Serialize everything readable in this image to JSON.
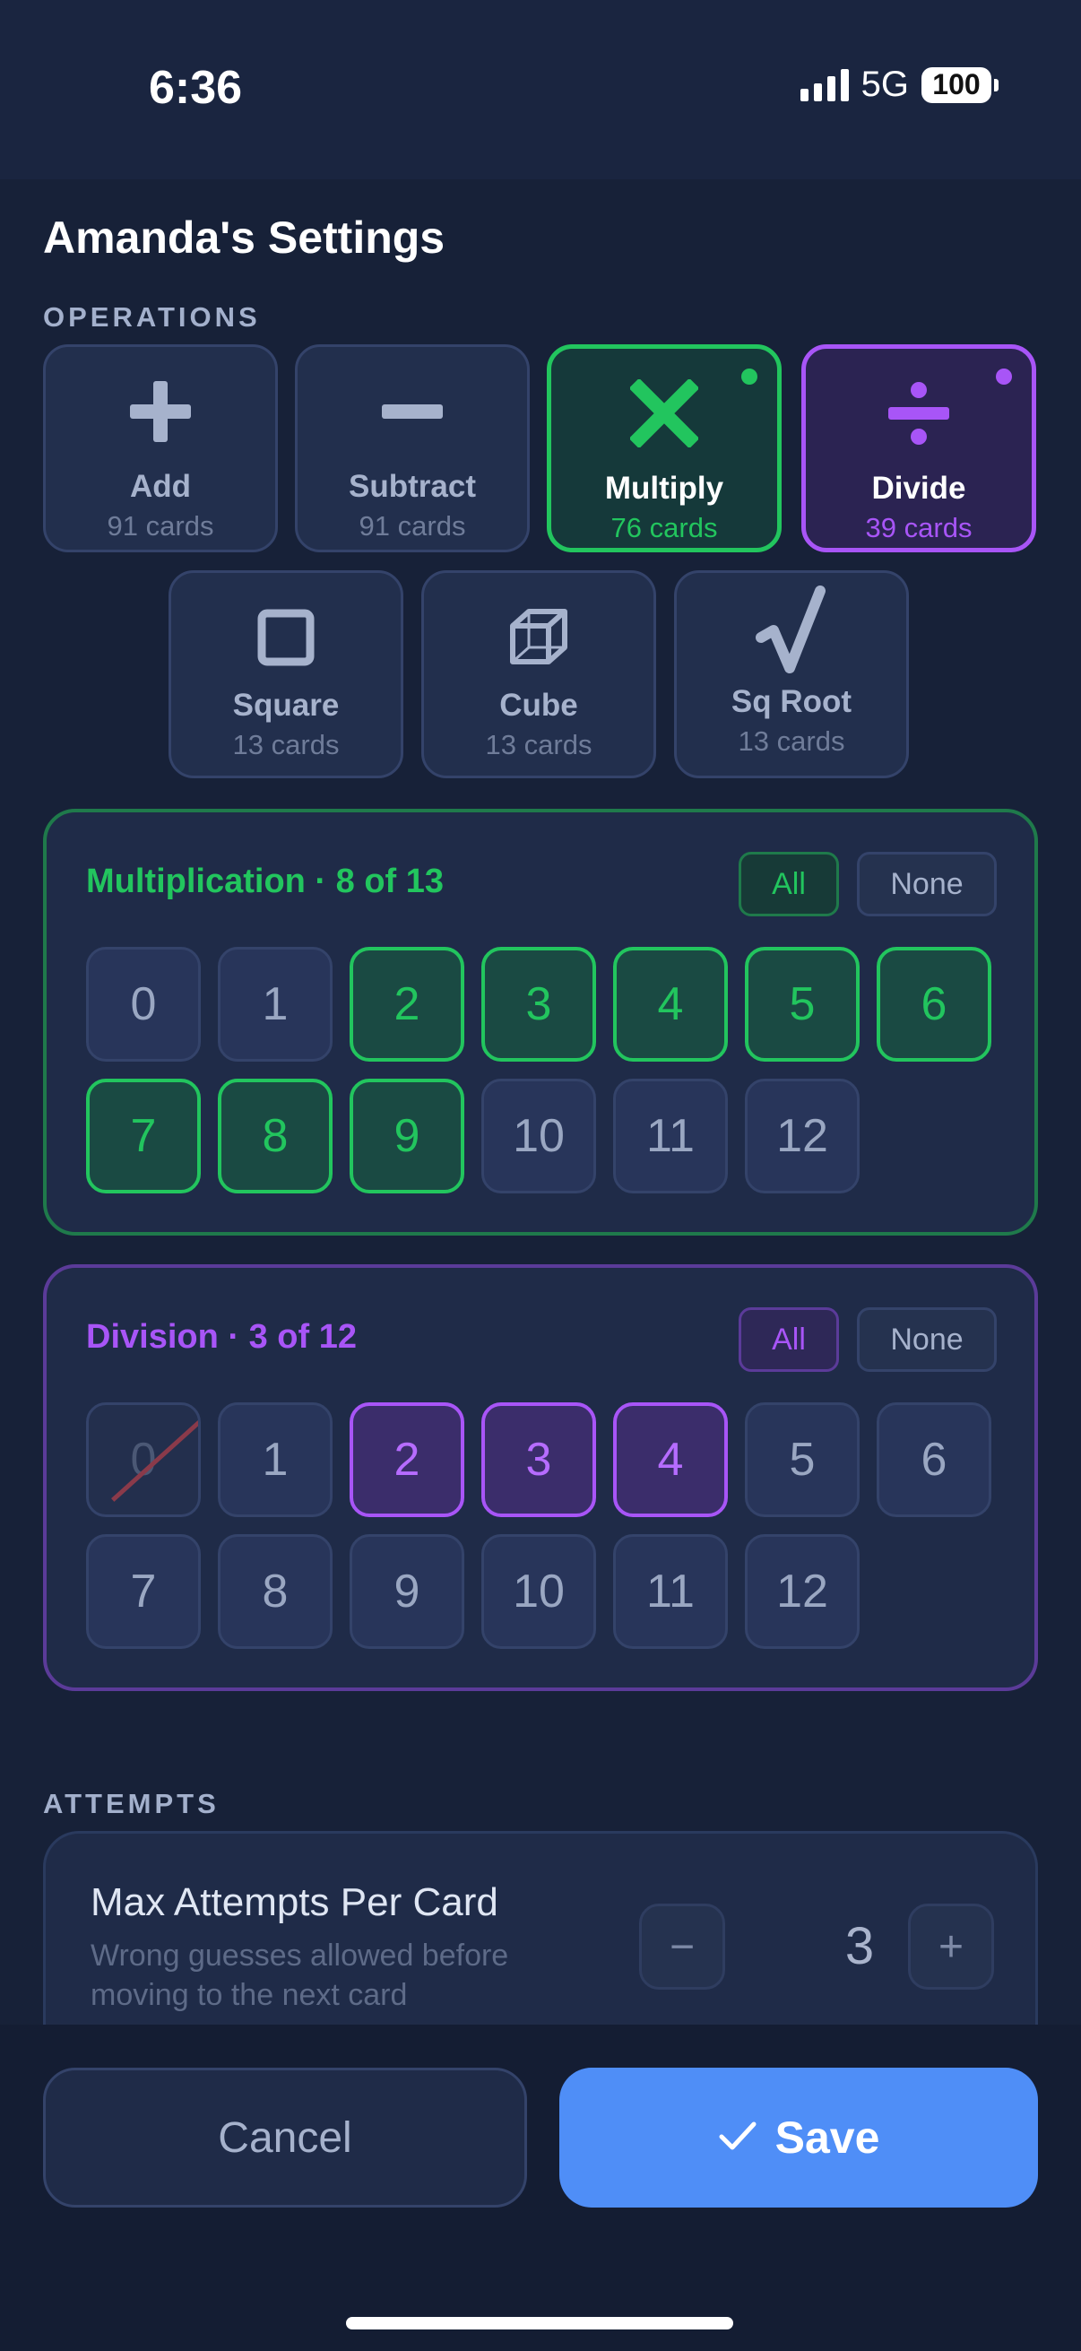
{
  "status": {
    "time": "6:36",
    "network": "5G",
    "battery": "100"
  },
  "page": {
    "title": "Amanda's Settings"
  },
  "sections": {
    "operations": "OPERATIONS",
    "attempts": "ATTEMPTS"
  },
  "operations": [
    {
      "name": "Add",
      "count": "91 cards",
      "glyph": "+",
      "state": "off"
    },
    {
      "name": "Subtract",
      "count": "91 cards",
      "glyph": "−",
      "state": "off"
    },
    {
      "name": "Multiply",
      "count": "76 cards",
      "glyph": "×",
      "state": "green"
    },
    {
      "name": "Divide",
      "count": "39 cards",
      "glyph": "÷",
      "state": "purple"
    },
    {
      "name": "Square",
      "count": "13 cards",
      "glyph": "square-icon",
      "state": "off"
    },
    {
      "name": "Cube",
      "count": "13 cards",
      "glyph": "cube-icon",
      "state": "off"
    },
    {
      "name": "Sq Root",
      "count": "13 cards",
      "glyph": "√",
      "state": "off"
    }
  ],
  "multiplication": {
    "title": "Multiplication · 8 of 13",
    "all_label": "All",
    "none_label": "None",
    "numbers": [
      "0",
      "1",
      "2",
      "3",
      "4",
      "5",
      "6",
      "7",
      "8",
      "9",
      "10",
      "11",
      "12"
    ],
    "selected": [
      "2",
      "3",
      "4",
      "5",
      "6",
      "7",
      "8",
      "9"
    ]
  },
  "division": {
    "title": "Division · 3 of 12",
    "all_label": "All",
    "none_label": "None",
    "numbers": [
      "0",
      "1",
      "2",
      "3",
      "4",
      "5",
      "6",
      "7",
      "8",
      "9",
      "10",
      "11",
      "12"
    ],
    "selected": [
      "2",
      "3",
      "4"
    ],
    "disabled": [
      "0"
    ]
  },
  "attempts": {
    "title": "Max Attempts Per Card",
    "subtitle": "Wrong guesses allowed before moving to the next card",
    "value": "3",
    "minus": "−",
    "plus": "+"
  },
  "actions": {
    "cancel": "Cancel",
    "save": "Save"
  },
  "colors": {
    "green": "#22c55e",
    "purple": "#a855f7",
    "save": "#4f8ef7"
  }
}
